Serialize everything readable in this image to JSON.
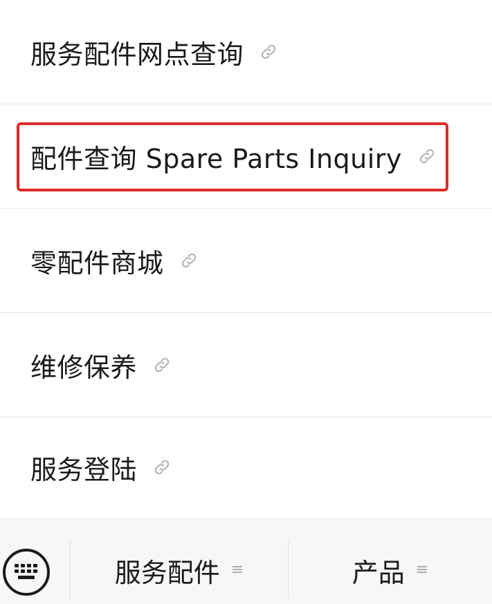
{
  "menu": {
    "items": [
      {
        "label": "服务配件网点查询",
        "icon": "link-icon"
      },
      {
        "label": "配件查询 Spare Parts Inquiry",
        "icon": "link-icon",
        "highlighted": true
      },
      {
        "label": "零配件商城",
        "icon": "link-icon"
      },
      {
        "label": "维修保养",
        "icon": "link-icon"
      },
      {
        "label": "服务登陆",
        "icon": "link-icon"
      }
    ]
  },
  "bottom_bar": {
    "keyboard_icon": "keyboard-icon",
    "tabs": [
      {
        "label": "服务配件",
        "icon": "menu-lines-icon",
        "icon_glyph": "≡"
      },
      {
        "label": "产品",
        "icon": "menu-lines-icon",
        "icon_glyph": "≡"
      }
    ]
  },
  "colors": {
    "highlight_border": "#e02a27",
    "text": "#1a1a1a",
    "icon": "#b3b3b3",
    "background": "#f7f7f7"
  }
}
